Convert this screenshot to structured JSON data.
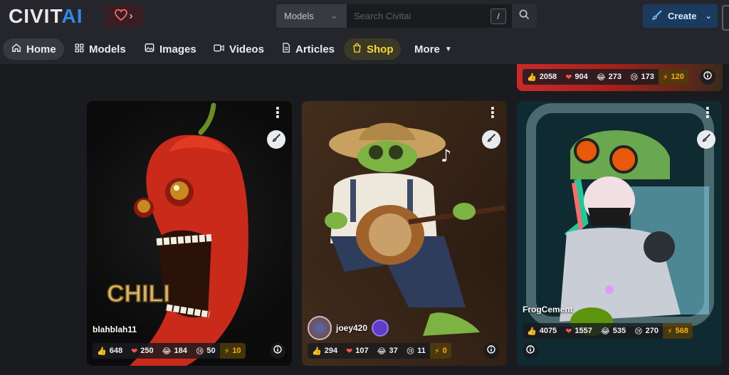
{
  "header": {
    "logo_part1": "CIVIT",
    "logo_part2": "AI",
    "search_category": "Models",
    "search_placeholder": "Search Civitai",
    "search_shortcut": "/",
    "create_label": "Create"
  },
  "nav": {
    "items": [
      {
        "label": "Home"
      },
      {
        "label": "Models"
      },
      {
        "label": "Images"
      },
      {
        "label": "Videos"
      },
      {
        "label": "Articles"
      },
      {
        "label": "Shop"
      },
      {
        "label": "More"
      }
    ]
  },
  "top_strip": {
    "likes": "2058",
    "hearts": "904",
    "laughs": "273",
    "cries": "173",
    "buzz": "120"
  },
  "cards": [
    {
      "username": "blahblah11",
      "likes": "648",
      "hearts": "250",
      "laughs": "184",
      "cries": "50",
      "buzz": "10",
      "art_text": "CHILI"
    },
    {
      "username": "joey420",
      "likes": "294",
      "hearts": "107",
      "laughs": "37",
      "cries": "11",
      "buzz": "0"
    },
    {
      "username": "FrogCement",
      "likes": "4075",
      "hearts": "1557",
      "laughs": "535",
      "cries": "270",
      "buzz": "568"
    }
  ],
  "colors": {
    "brand_blue": "#2f8ae5",
    "heart": "#fa5252",
    "buzz": "#fab005",
    "background": "#1a1b1e"
  }
}
